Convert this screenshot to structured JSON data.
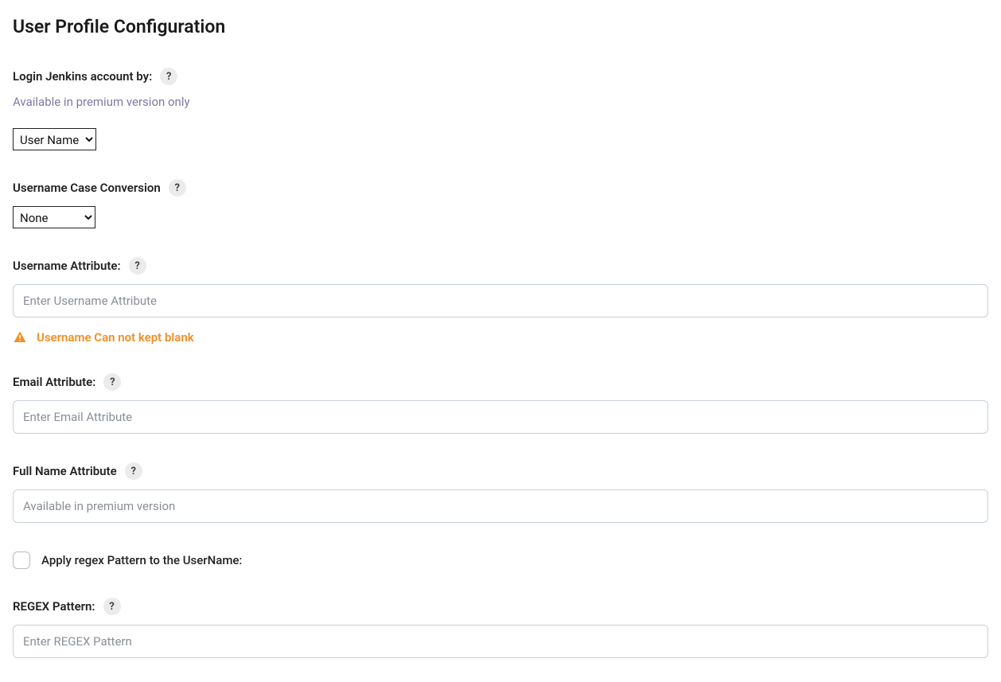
{
  "page": {
    "title": "User Profile Configuration"
  },
  "help_glyph": "?",
  "loginBy": {
    "label": "Login Jenkins account by:",
    "premium_note": "Available in premium version only",
    "selected": "User Name"
  },
  "caseConversion": {
    "label": "Username Case Conversion",
    "selected": "None"
  },
  "usernameAttr": {
    "label": "Username Attribute:",
    "placeholder": "Enter Username Attribute",
    "value": "",
    "validation_msg": "Username Can not kept blank"
  },
  "emailAttr": {
    "label": "Email Attribute:",
    "placeholder": "Enter Email Attribute",
    "value": ""
  },
  "fullNameAttr": {
    "label": "Full Name Attribute",
    "placeholder": "Available in premium version",
    "value": ""
  },
  "applyRegex": {
    "label": "Apply regex Pattern to the UserName:",
    "checked": false
  },
  "regexPattern": {
    "label": "REGEX Pattern:",
    "placeholder": "Enter REGEX Pattern",
    "value": ""
  }
}
